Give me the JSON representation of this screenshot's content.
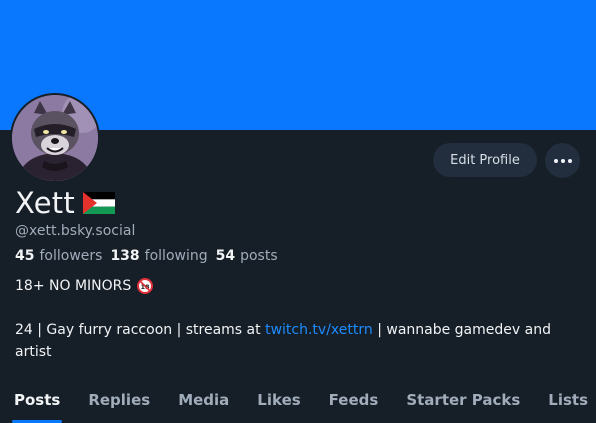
{
  "profile": {
    "display_name": "Xett",
    "handle": "@xett.bsky.social",
    "stats": {
      "followers_count": "45",
      "followers_label": "followers",
      "following_count": "138",
      "following_label": "following",
      "posts_count": "54",
      "posts_label": "posts"
    },
    "description_line1": "18+ NO MINORS",
    "description_line2_prefix": "24 | Gay furry raccoon | streams at ",
    "description_link": "twitch.tv/xettrn",
    "description_line2_suffix": " | wannabe gamedev and artist",
    "flag_icon": "palestine-flag-icon",
    "minors_icon": "no-under-18-icon"
  },
  "actions": {
    "edit_profile_label": "Edit Profile",
    "more_icon": "ellipsis-icon"
  },
  "tabs": [
    {
      "label": "Posts",
      "active": true
    },
    {
      "label": "Replies",
      "active": false
    },
    {
      "label": "Media",
      "active": false
    },
    {
      "label": "Likes",
      "active": false
    },
    {
      "label": "Feeds",
      "active": false
    },
    {
      "label": "Starter Packs",
      "active": false
    },
    {
      "label": "Lists",
      "active": false
    }
  ],
  "colors": {
    "banner": "#0a77ff",
    "background": "#161e27",
    "link": "#1d8cff",
    "muted_text": "#a0acba"
  }
}
